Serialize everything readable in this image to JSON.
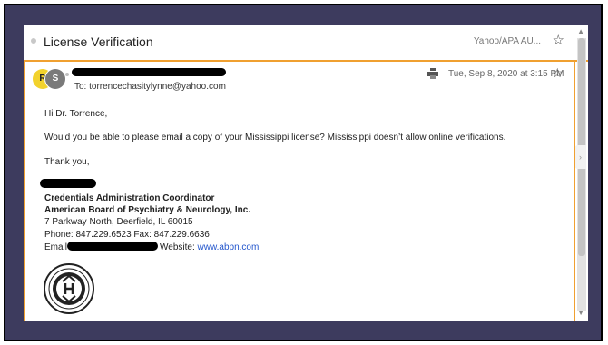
{
  "header": {
    "subject": "License Verification",
    "folder": "Yahoo/APA AU...",
    "star_icon": "star-outline-icon"
  },
  "message": {
    "avatar_initial_1": "R",
    "avatar_initial_2": "S",
    "to_line": "To: torrencechasitylynne@yahoo.com",
    "date": "Tue, Sep 8, 2020 at 3:15 PM",
    "greeting": "Hi Dr. Torrence,",
    "body": "Would you be able to please email a copy of your Mississippi license? Mississippi doesn’t allow online verifications.",
    "closing": "Thank you,"
  },
  "signature": {
    "title": "Credentials Administration Coordinator",
    "organization": "American Board of Psychiatry & Neurology, Inc.",
    "address": "7 Parkway North, Deerfield, IL 60015",
    "phone_fax": "Phone:  847.229.6523  Fax:  847.229.6636",
    "email_label": "Email",
    "website_label": "Website: ",
    "website_url": "www.abpn.com"
  },
  "colors": {
    "accent": "#f0a030",
    "avatar_r": "#f2d22d",
    "avatar_s": "#7a7a7a",
    "link": "#2255cc",
    "frame": "#3d3b5e"
  }
}
